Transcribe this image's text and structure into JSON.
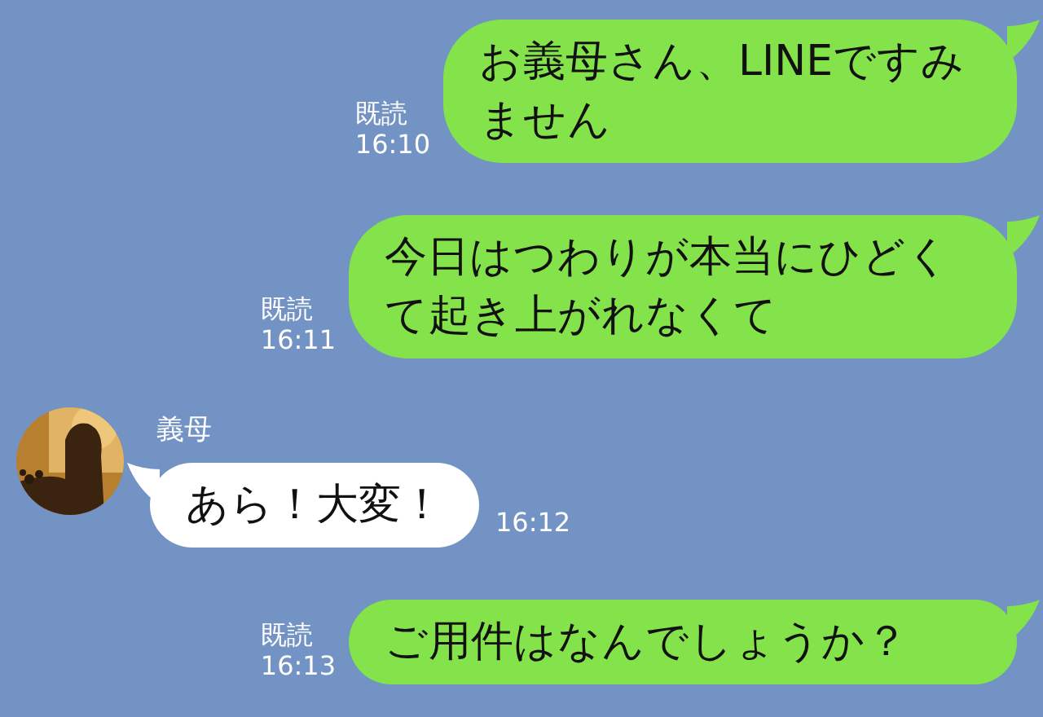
{
  "messages": [
    {
      "kind": "sent",
      "read_label": "既読",
      "time": "16:10",
      "text": "お義母さん、LINEですみません"
    },
    {
      "kind": "sent",
      "read_label": "既読",
      "time": "16:11",
      "text": "今日はつわりが本当にひどくて起き上がれなくて"
    },
    {
      "kind": "received",
      "sender": "義母",
      "time": "16:12",
      "text": "あら！大変！"
    },
    {
      "kind": "sent",
      "read_label": "既読",
      "time": "16:13",
      "text": "ご用件はなんでしょうか？"
    }
  ]
}
